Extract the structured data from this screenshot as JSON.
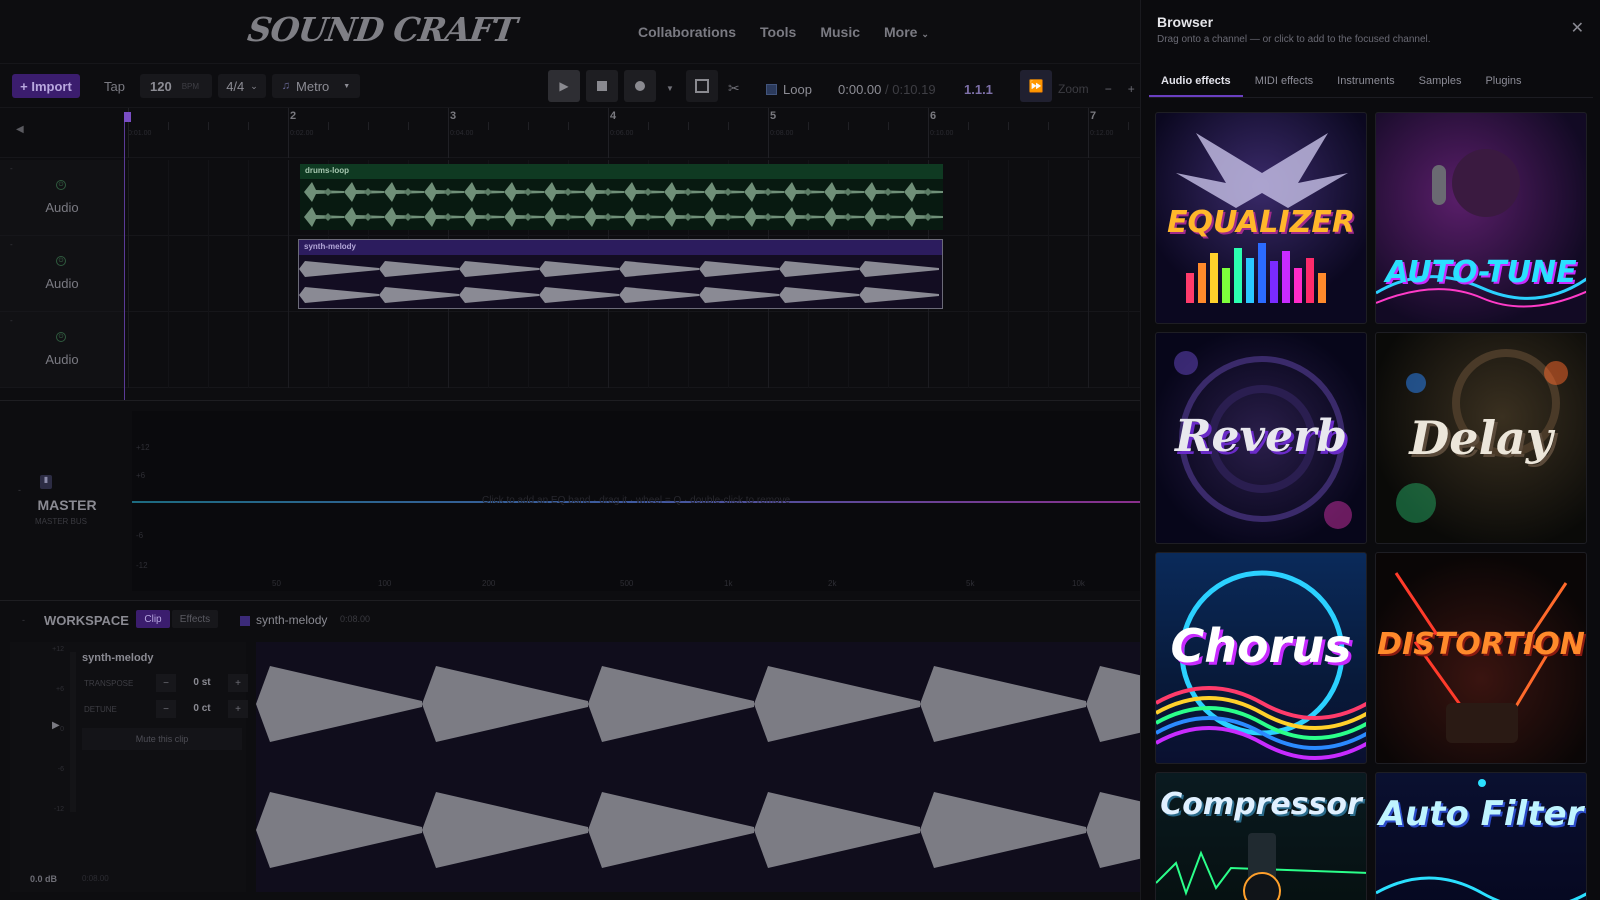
{
  "app": {
    "logo": "SOUND CRAFT",
    "nav": [
      "Collaborations",
      "Tools",
      "Music",
      "More"
    ]
  },
  "toolbar": {
    "import_label": "+ Import",
    "tap_label": "Tap",
    "bpm_value": "120",
    "bpm_unit": "BPM",
    "time_signature": "4/4",
    "metro_label": "Metro",
    "loop_label": "Loop",
    "time_current": "0:00.00",
    "time_total": "/ 0:10.19",
    "position": "1.1.1",
    "zoom_label": "Zoom",
    "zoom_minus": "−",
    "zoom_plus": "+"
  },
  "ruler": {
    "bars": [
      "2",
      "3",
      "4",
      "5",
      "6",
      "7"
    ],
    "times": [
      "0:01.00",
      "0:02.00",
      "0:04.00",
      "0:06.00",
      "0:08.00",
      "0:10.00",
      "0:12.00"
    ]
  },
  "tracks": [
    {
      "label": "Audio"
    },
    {
      "label": "Audio"
    },
    {
      "label": "Audio"
    }
  ],
  "clips": {
    "drums": "drums-loop",
    "synth": "synth-melody"
  },
  "master": {
    "name": "MASTER",
    "sub": "MASTER BUS",
    "hint": "Click to add an EQ band · drag it · wheel = Q · double-click to remove",
    "db_labels": [
      "+12",
      "+6",
      "-6",
      "-12"
    ],
    "freq_labels": [
      "50",
      "100",
      "200",
      "500",
      "1k",
      "2k",
      "5k",
      "10k"
    ]
  },
  "workspace": {
    "title": "WORKSPACE",
    "tab_clip": "Clip",
    "tab_effects": "Effects",
    "clip_name": "synth-melody",
    "clip_length": "0:08.00",
    "panel_name": "synth-melody",
    "transpose_label": "TRANSPOSE",
    "transpose_value": "0 st",
    "detune_label": "DETUNE",
    "detune_value": "0 ct",
    "mute_label": "Mute this clip",
    "meter_db": [
      "+12",
      "+6",
      "0",
      "-6",
      "-12"
    ],
    "volume": "0.0 dB",
    "time": "0:08.00"
  },
  "browser": {
    "title": "Browser",
    "subtitle": "Drag onto a channel — or click to add to the focused channel.",
    "tabs": [
      "Audio effects",
      "MIDI effects",
      "Instruments",
      "Samples",
      "Plugins"
    ],
    "active_tab": "Audio effects",
    "cards": [
      "EQUALIZER",
      "AUTO-TUNE",
      "Reverb",
      "Delay",
      "Chorus",
      "DISTORTION",
      "Compressor",
      "Auto Filter"
    ]
  }
}
